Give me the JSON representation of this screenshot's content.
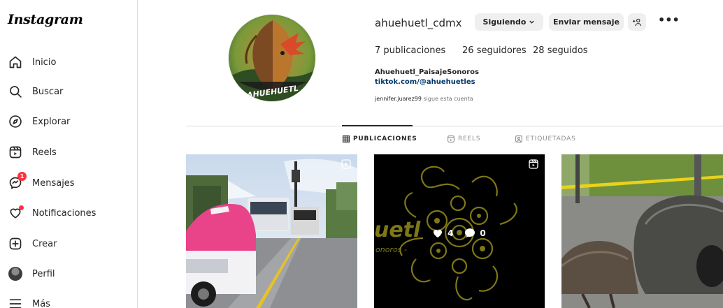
{
  "app": {
    "logo": "Instagram"
  },
  "sidebar": {
    "items": [
      {
        "label": "Inicio",
        "icon": "home-icon"
      },
      {
        "label": "Buscar",
        "icon": "search-icon"
      },
      {
        "label": "Explorar",
        "icon": "compass-icon"
      },
      {
        "label": "Reels",
        "icon": "reels-icon"
      },
      {
        "label": "Mensajes",
        "icon": "messenger-icon",
        "badge": "1"
      },
      {
        "label": "Notificaciones",
        "icon": "heart-icon"
      },
      {
        "label": "Crear",
        "icon": "plus-square-icon"
      },
      {
        "label": "Perfil",
        "icon": "avatar"
      },
      {
        "label": "Más",
        "icon": "menu-icon"
      }
    ]
  },
  "profile": {
    "username": "ahuehuetl_cdmx",
    "following_button": "Siguiendo",
    "message_button": "Enviar mensaje",
    "stats": {
      "posts_count": "7",
      "posts_label": "publicaciones",
      "followers_count": "26",
      "followers_label": "seguidores",
      "following_count": "28",
      "following_label": "seguidos"
    },
    "full_name": "Ahuehuetl_PaisajeSonoros",
    "link": "tiktok.com/@ahuehuetles",
    "followed_by_user": "jennifer.juarez99",
    "followed_by_text": "sigue esta cuenta",
    "avatar_text": "AHUEHUETL"
  },
  "tabs": [
    {
      "label": "PUBLICACIONES",
      "active": true
    },
    {
      "label": "REELS",
      "active": false
    },
    {
      "label": "ETIQUETADAS",
      "active": false
    }
  ],
  "posts": [
    {
      "type": "reel"
    },
    {
      "type": "reel",
      "likes": "4",
      "comments": "0",
      "text_left": "uetl",
      "text_sub": "onoros -"
    },
    {
      "type": "image"
    }
  ],
  "colors": {
    "accent": "#0095f6",
    "badge": "#ff3040",
    "link": "#00376b",
    "muted": "#737373"
  }
}
